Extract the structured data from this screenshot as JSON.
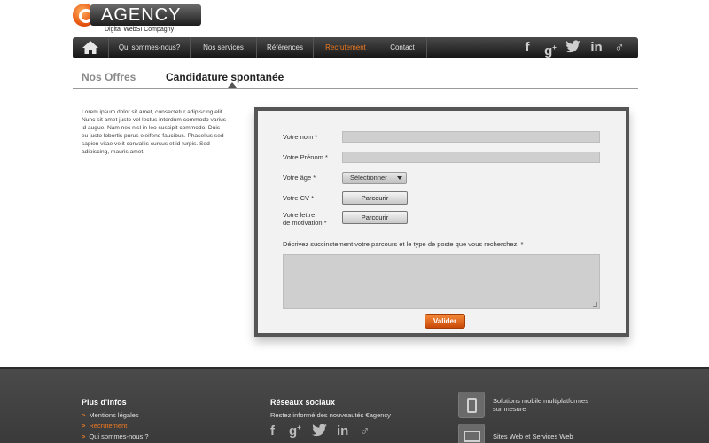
{
  "brand": {
    "logo_text": "AGENCY",
    "tagline": "Digital WebSI Compagny"
  },
  "nav": {
    "home_icon": "home-icon",
    "items": [
      {
        "label": "Qui sommes-nous?"
      },
      {
        "label": "Nos services"
      },
      {
        "label": "Références"
      },
      {
        "label": "Recrutement"
      },
      {
        "label": "Contact"
      }
    ],
    "social_icons": [
      "facebook-icon",
      "google-plus-icon",
      "twitter-icon",
      "linkedin-icon",
      "male-symbol-icon"
    ]
  },
  "tabs": [
    {
      "label": "Nos Offres"
    },
    {
      "label": "Candidature spontanée"
    }
  ],
  "intro_text": "Lorem ipsum dolor sit amet, consectetur adipiscing elit. Nunc sit amet justo vel lectus interdum commodo varius id augue. Nam nec nisl in leo suscipit commodo. Duis eu justo lobortis purus eleifend faucibus. Phasellus sed sapien vitae velit convallis cursus et id turpis. Sed adipiscing, mauris amet.",
  "form": {
    "nom_label": "Votre nom *",
    "prenom_label": "Votre Prénom *",
    "age_label": "Votre âge *",
    "age_select_value": "Sélectionner",
    "cv_label": "Votre CV *",
    "lettre_label_line1": "Votre lettre",
    "lettre_label_line2": "de motivation *",
    "browse_label": "Parcourir",
    "description_label": "Décrivez succinctement votre parcours et le type de poste que vous recherchez. *",
    "submit_label": "Valider"
  },
  "footer": {
    "infos_title": "Plus d'infos",
    "infos_links": [
      {
        "label": "Mentions légales"
      },
      {
        "label": "Recrutement"
      },
      {
        "label": "Qui sommes-nous ?"
      }
    ],
    "social_title": "Réseaux sociaux",
    "social_text": "Restez informé des nouveautés €agency",
    "services": [
      {
        "line1": "Solutions mobile multiplatformes",
        "line2": "sur mesure",
        "icon": "mobile-icon"
      },
      {
        "line1": "Sites Web et Services Web",
        "line2": "",
        "icon": "monitor-icon"
      }
    ]
  },
  "colors": {
    "accent": "#f07a20",
    "nav_bg": "#1d1d1d",
    "footer_bg": "#3f3f3f",
    "panel_border": "#555555"
  }
}
